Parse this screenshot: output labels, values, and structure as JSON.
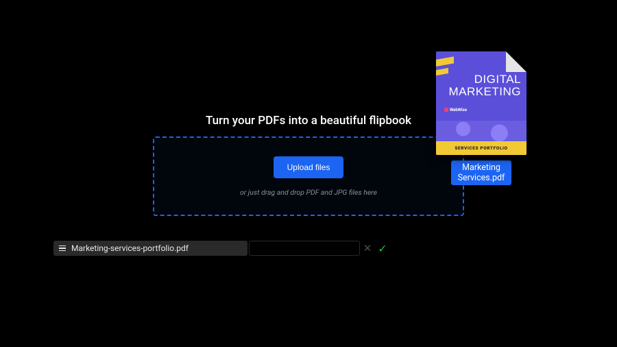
{
  "headline": "Turn your PDFs into a beautiful flipbook",
  "dropzone": {
    "button_label": "Upload files",
    "hint": "or just drag and drop PDF and JPG files here"
  },
  "dragged_file": {
    "label": "Marketing\nServices.pdf",
    "cover_title": "DIGITAL\nMARKETING",
    "cover_brand": "WebWise",
    "cover_footer": "SERVICES PORTFOLIO"
  },
  "upload_row": {
    "filename": "Marketing-services-portfolio.pdf"
  }
}
